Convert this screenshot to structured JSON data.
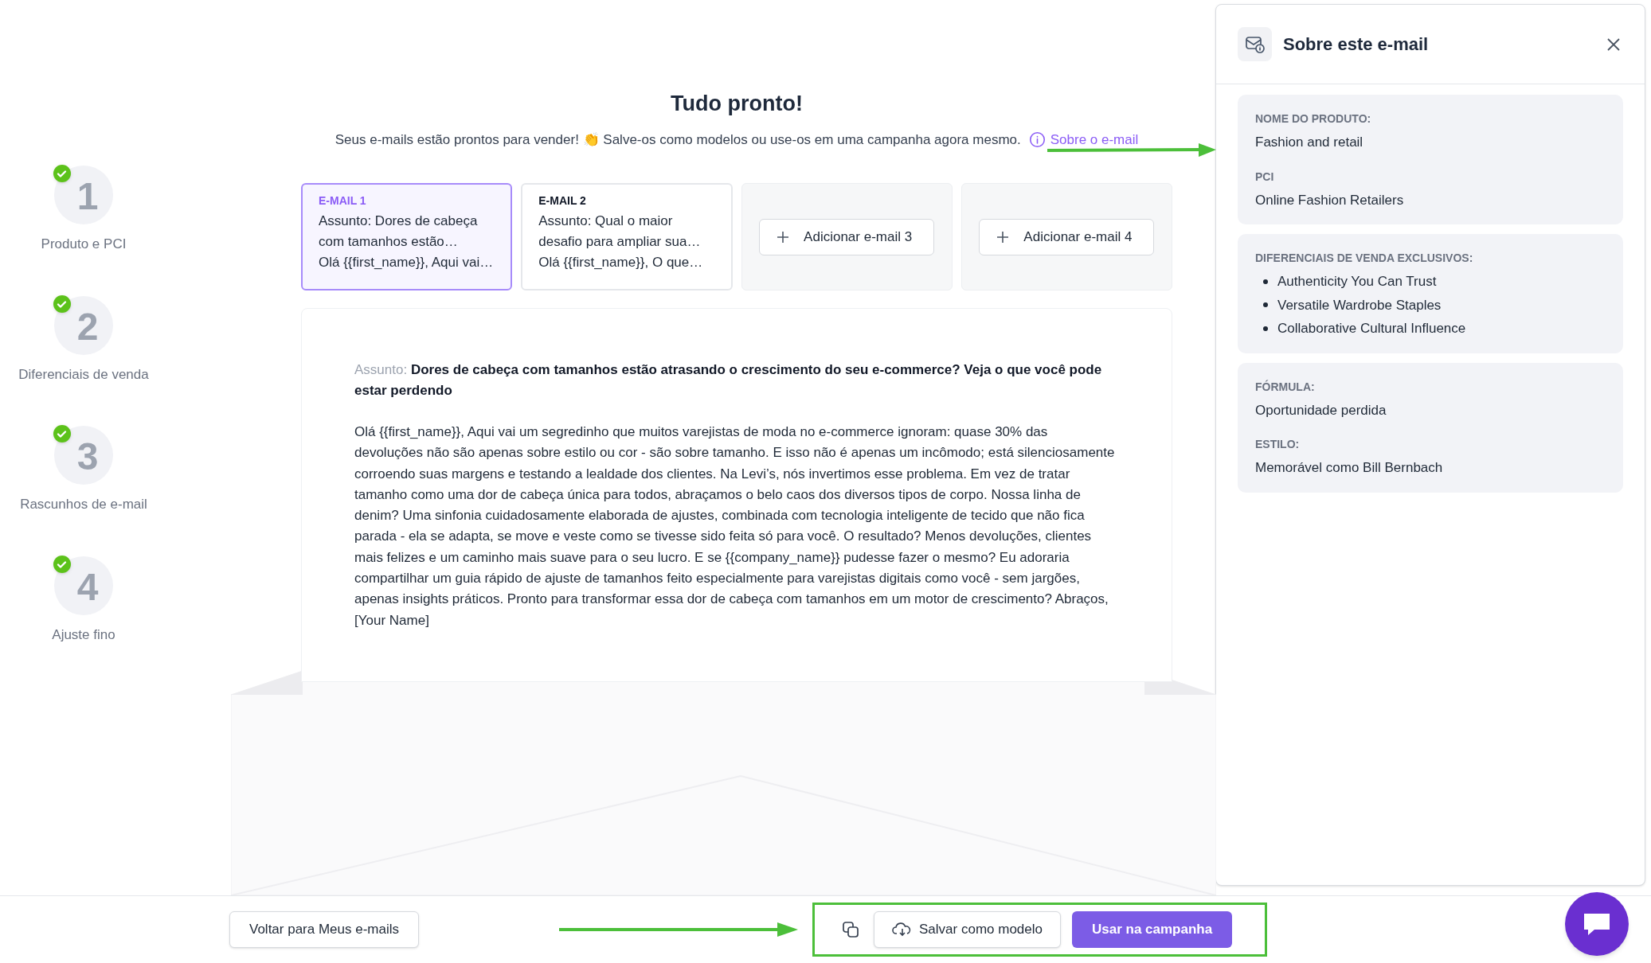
{
  "steps": [
    {
      "number": "1",
      "label": "Produto e PCI",
      "completed": true
    },
    {
      "number": "2",
      "label": "Diferenciais de venda",
      "completed": true
    },
    {
      "number": "3",
      "label": "Rascunhos de e-mail",
      "completed": true
    },
    {
      "number": "4",
      "label": "Ajuste fino",
      "completed": true
    }
  ],
  "header": {
    "title": "Tudo pronto!",
    "subtitle": "Seus e-mails estão prontos para vender! 👏 Salve-os como modelos ou use-os em uma campanha agora mesmo.",
    "link": "Sobre o e-mail"
  },
  "email_tabs": [
    {
      "kind": "email",
      "label": "E-MAIL 1",
      "subject": "Assunto: Dores de cabeça com tamanhos estão…",
      "preview": "Olá {{first_name}}, Aqui vai…",
      "selected": true
    },
    {
      "kind": "email",
      "label": "E-MAIL 2",
      "subject": "Assunto: Qual o maior desafio para ampliar sua…",
      "preview": "Olá {{first_name}}, O que…",
      "selected": false
    },
    {
      "kind": "add",
      "label": "Adicionar e-mail 3"
    },
    {
      "kind": "add",
      "label": "Adicionar e-mail 4"
    }
  ],
  "email": {
    "subject_label": "Assunto:",
    "subject": "Dores de cabeça com tamanhos estão atrasando o crescimento do seu e-commerce? Veja o que você pode estar perdendo",
    "body": "Olá {{first_name}}, Aqui vai um segredinho que muitos varejistas de moda no e-commerce ignoram: quase 30% das devoluções não são apenas sobre estilo ou cor - são sobre tamanho. E isso não é apenas um incômodo; está silenciosamente corroendo suas margens e testando a lealdade dos clientes. Na Levi’s, nós invertimos esse problema. Em vez de tratar tamanho como uma dor de cabeça única para todos, abraçamos o belo caos dos diversos tipos de corpo. Nossa linha de denim? Uma sinfonia cuidadosamente elaborada de ajustes, combinada com tecnologia inteligente de tecido que não fica parada - ela se adapta, se move e veste como se tivesse sido feita só para você. O resultado? Menos devoluções, clientes mais felizes e um caminho mais suave para o seu lucro. E se {{company_name}} pudesse fazer o mesmo? Eu adoraria compartilhar um guia rápido de ajuste de tamanhos feito especialmente para varejistas digitais como você - sem jargões, apenas insights práticos. Pronto para transformar essa dor de cabeça com tamanhos em um motor de crescimento? Abraços, [Your Name]"
  },
  "panel": {
    "title": "Sobre este e-mail",
    "sections": [
      {
        "fields": [
          {
            "kind": "text",
            "label": "NOME DO PRODUTO:",
            "value": "Fashion and retail"
          },
          {
            "kind": "text",
            "label": "PCI",
            "value": "Online Fashion Retailers"
          }
        ]
      },
      {
        "fields": [
          {
            "kind": "list",
            "label": "DIFERENCIAIS DE VENDA EXCLUSIVOS:",
            "items": [
              "Authenticity You Can Trust",
              "Versatile Wardrobe Staples",
              "Collaborative Cultural Influence"
            ]
          }
        ]
      },
      {
        "fields": [
          {
            "kind": "text",
            "label": "FÓRMULA:",
            "value": "Oportunidade perdida"
          },
          {
            "kind": "text",
            "label": "ESTILO:",
            "value": "Memorável como Bill Bernbach"
          }
        ]
      }
    ]
  },
  "footer": {
    "back_button": "Voltar para Meus e-mails",
    "save_button": "Salvar como modelo",
    "campaign_button": "Usar na campanha"
  }
}
